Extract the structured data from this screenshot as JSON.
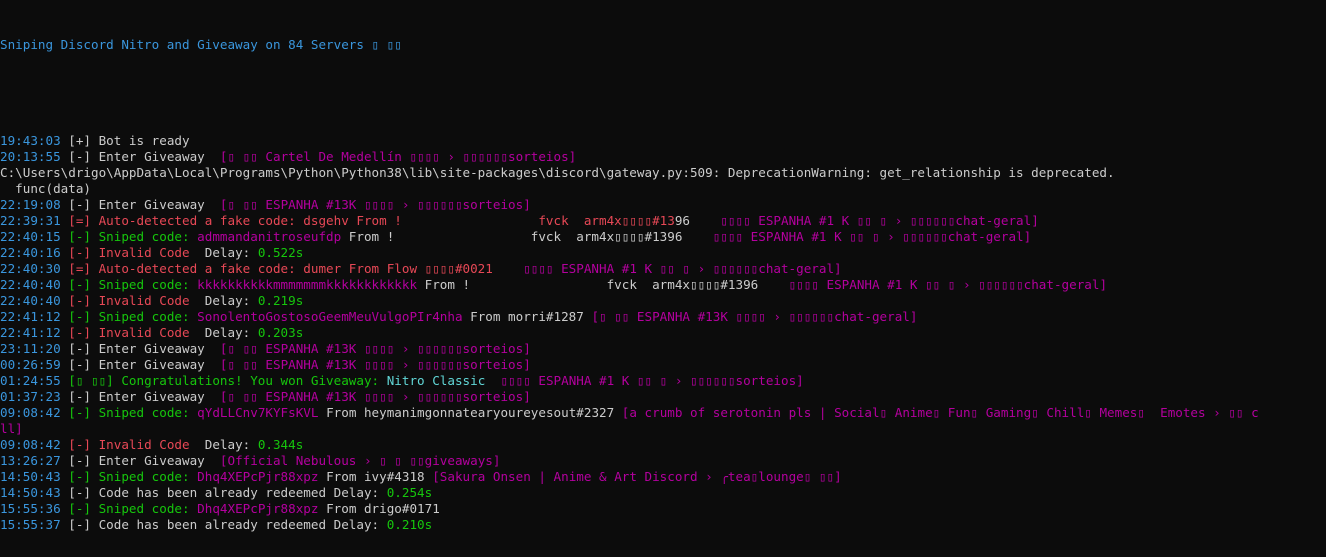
{
  "window": {
    "title": "Sniping Discord Nitro and Giveaway on 84 Servers ▯ ▯▯"
  },
  "colors": {
    "background": "#0c0c0c",
    "default_text": "#cccccc",
    "timestamp": "#3a96dd",
    "error": "#e74856",
    "success": "#16c60c",
    "channel": "#b4009e",
    "prize": "#61d6d6"
  },
  "lines": [
    {
      "time": "19:43:03",
      "segments": [
        {
          "t": " [+] Bot is ready",
          "c": "white"
        }
      ]
    },
    {
      "time": "20:13:55",
      "segments": [
        {
          "t": " [-] Enter Giveaway  ",
          "c": "white"
        },
        {
          "t": "[▯ ▯▯ Cartel De Medellín ▯▯▯▯ › ▯▯▯▯▯▯sorteios]",
          "c": "magenta"
        }
      ]
    },
    {
      "time": "",
      "segments": [
        {
          "t": "C:\\Users\\drigo\\AppData\\Local\\Programs\\Python\\Python38\\lib\\site-packages\\discord\\gateway.py:509: DeprecationWarning: get_relationship is deprecated.",
          "c": "white"
        }
      ]
    },
    {
      "time": "",
      "segments": [
        {
          "t": "  func(data)",
          "c": "white"
        }
      ]
    },
    {
      "time": "22:19:08",
      "segments": [
        {
          "t": " [-] Enter Giveaway  ",
          "c": "white"
        },
        {
          "t": "[▯ ▯▯ ESPANHA #13K ▯▯▯▯ › ▯▯▯▯▯▯sorteios]",
          "c": "magenta"
        }
      ]
    },
    {
      "time": "22:39:31",
      "segments": [
        {
          "t": " [=] Auto-detected a fake code: dsgehv From !                  fvck  arm4x▯▯▯▯#13",
          "c": "red"
        },
        {
          "t": "96    ",
          "c": "white"
        },
        {
          "t": "▯▯▯▯ ESPANHA #1 K ▯▯ ▯ › ▯▯▯▯▯▯chat-geral]",
          "c": "magenta"
        }
      ]
    },
    {
      "time": "22:40:15",
      "segments": [
        {
          "t": " [-] Sniped code: ",
          "c": "green"
        },
        {
          "t": "admmandanitroseufdp",
          "c": "magenta"
        },
        {
          "t": " From !                  fvck  arm4x▯▯▯▯#1396    ",
          "c": "white"
        },
        {
          "t": "▯▯▯▯ ESPANHA #1 K ▯▯ ▯ › ▯▯▯▯▯▯chat-geral]",
          "c": "magenta"
        }
      ]
    },
    {
      "time": "22:40:16",
      "segments": [
        {
          "t": " [-] Invalid Code  ",
          "c": "red"
        },
        {
          "t": "Delay: ",
          "c": "white"
        },
        {
          "t": "0.522s",
          "c": "green"
        }
      ]
    },
    {
      "time": "22:40:30",
      "segments": [
        {
          "t": " [=] Auto-detected a fake code: dumer From Flow ▯▯▯▯#0021    ",
          "c": "red"
        },
        {
          "t": "▯▯▯▯ ESPANHA #1 K ▯▯ ▯ › ▯▯▯▯▯▯chat-geral]",
          "c": "magenta"
        }
      ]
    },
    {
      "time": "22:40:40",
      "segments": [
        {
          "t": " [-] Sniped code: ",
          "c": "green"
        },
        {
          "t": "kkkkkkkkkkmmmmmmmkkkkkkkkkkkk",
          "c": "magenta"
        },
        {
          "t": " From !                  fvck  arm4x▯▯▯▯#1396    ",
          "c": "white"
        },
        {
          "t": "▯▯▯▯ ESPANHA #1 K ▯▯ ▯ › ▯▯▯▯▯▯chat-geral]",
          "c": "magenta"
        }
      ]
    },
    {
      "time": "22:40:40",
      "segments": [
        {
          "t": " [-] Invalid Code  ",
          "c": "red"
        },
        {
          "t": "Delay: ",
          "c": "white"
        },
        {
          "t": "0.219s",
          "c": "green"
        }
      ]
    },
    {
      "time": "22:41:12",
      "segments": [
        {
          "t": " [-] Sniped code: ",
          "c": "green"
        },
        {
          "t": "SonolentoGostosoGeemMeuVulgoPIr4nha",
          "c": "magenta"
        },
        {
          "t": " From morri#1287 ",
          "c": "white"
        },
        {
          "t": "[▯ ▯▯ ESPANHA #13K ▯▯▯▯ › ▯▯▯▯▯▯chat-geral]",
          "c": "magenta"
        }
      ]
    },
    {
      "time": "22:41:12",
      "segments": [
        {
          "t": " [-] Invalid Code  ",
          "c": "red"
        },
        {
          "t": "Delay: ",
          "c": "white"
        },
        {
          "t": "0.203s",
          "c": "green"
        }
      ]
    },
    {
      "time": "23:11:20",
      "segments": [
        {
          "t": " [-] Enter Giveaway  ",
          "c": "white"
        },
        {
          "t": "[▯ ▯▯ ESPANHA #13K ▯▯▯▯ › ▯▯▯▯▯▯sorteios]",
          "c": "magenta"
        }
      ]
    },
    {
      "time": "00:26:59",
      "segments": [
        {
          "t": " [-] Enter Giveaway  ",
          "c": "white"
        },
        {
          "t": "[▯ ▯▯ ESPANHA #13K ▯▯▯▯ › ▯▯▯▯▯▯sorteios]",
          "c": "magenta"
        }
      ]
    },
    {
      "time": "01:24:55",
      "segments": [
        {
          "t": " [▯ ▯▯] Congratulations! You won Giveaway: ",
          "c": "green"
        },
        {
          "t": "Nitro Classic",
          "c": "cyan"
        },
        {
          "t": "  ",
          "c": "white"
        },
        {
          "t": "▯▯▯▯ ESPANHA #1 K ▯▯ ▯ › ▯▯▯▯▯▯sorteios]",
          "c": "magenta"
        }
      ]
    },
    {
      "time": "01:37:23",
      "segments": [
        {
          "t": " [-] Enter Giveaway  ",
          "c": "white"
        },
        {
          "t": "[▯ ▯▯ ESPANHA #13K ▯▯▯▯ › ▯▯▯▯▯▯sorteios]",
          "c": "magenta"
        }
      ]
    },
    {
      "time": "09:08:42",
      "segments": [
        {
          "t": " [-] Sniped code: ",
          "c": "green"
        },
        {
          "t": "qYdLLCnv7KYFsKVL",
          "c": "magenta"
        },
        {
          "t": " From heymanimgonnatearyoureyesout#2327 ",
          "c": "white"
        },
        {
          "t": "[a crumb of serotonin pls | Social▯ Anime▯ Fun▯ Gaming▯ Chill▯ Memes▯  Emotes › ▯▯ c",
          "c": "magenta"
        }
      ]
    },
    {
      "time": "",
      "segments": [
        {
          "t": "ll]",
          "c": "magenta"
        }
      ]
    },
    {
      "time": "09:08:42",
      "segments": [
        {
          "t": " [-] Invalid Code  ",
          "c": "red"
        },
        {
          "t": "Delay: ",
          "c": "white"
        },
        {
          "t": "0.344s",
          "c": "green"
        }
      ]
    },
    {
      "time": "13:26:27",
      "segments": [
        {
          "t": " [-] Enter Giveaway  ",
          "c": "white"
        },
        {
          "t": "[Official Nebulous › ▯ ▯ ▯▯giveaways]",
          "c": "magenta"
        }
      ]
    },
    {
      "time": "14:50:43",
      "segments": [
        {
          "t": " [-] Sniped code: ",
          "c": "green"
        },
        {
          "t": "Dhq4XEPcPjr88xpz",
          "c": "magenta"
        },
        {
          "t": " From ivy#4318 ",
          "c": "white"
        },
        {
          "t": "[Sakura Onsen | Anime & Art Discord › ╭tea▯lounge▯ ▯▯]",
          "c": "magenta"
        }
      ]
    },
    {
      "time": "14:50:43",
      "segments": [
        {
          "t": " [-] Code has been already redeemed Delay: ",
          "c": "white"
        },
        {
          "t": "0.254s",
          "c": "green"
        }
      ]
    },
    {
      "time": "15:55:36",
      "segments": [
        {
          "t": " [-] Sniped code: ",
          "c": "green"
        },
        {
          "t": "Dhq4XEPcPjr88xpz",
          "c": "magenta"
        },
        {
          "t": " From drigo#0171",
          "c": "white"
        }
      ]
    },
    {
      "time": "15:55:37",
      "segments": [
        {
          "t": " [-] Code has been already redeemed Delay: ",
          "c": "white"
        },
        {
          "t": "0.210s",
          "c": "green"
        }
      ]
    }
  ]
}
